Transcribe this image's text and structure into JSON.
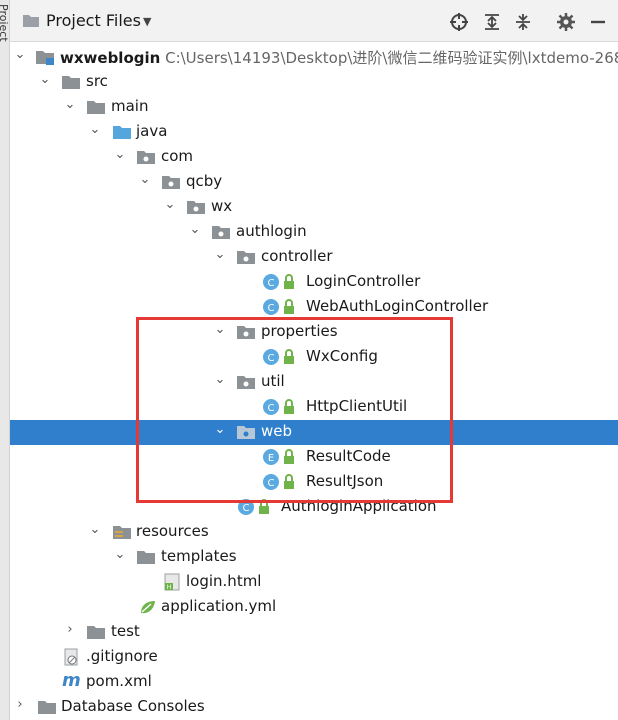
{
  "side_tab": "Project",
  "header": {
    "title": "Project Files"
  },
  "tree": {
    "root_name": "wxweblogin",
    "root_path": "C:\\Users\\14193\\Desktop\\进阶\\微信二维码验证实例\\lxtdemo-268",
    "src": "src",
    "main": "main",
    "java": "java",
    "com": "com",
    "qcby": "qcby",
    "wx": "wx",
    "authlogin": "authlogin",
    "controller": "controller",
    "login_controller": "LoginController",
    "web_auth_login_controller": "WebAuthLoginController",
    "properties": "properties",
    "wx_config": "WxConfig",
    "util": "util",
    "http_client_util": "HttpClientUtil",
    "web": "web",
    "result_code": "ResultCode",
    "result_json": "ResultJson",
    "authlogin_application": "AuthloginApplication",
    "resources": "resources",
    "templates": "templates",
    "login_html": "login.html",
    "application_yml": "application.yml",
    "test": "test",
    "gitignore": ".gitignore",
    "pom_xml": "pom.xml",
    "database_consoles": "Database Consoles"
  },
  "icons": {
    "header": [
      "folder-icon",
      "locate-icon",
      "expand-all-icon",
      "collapse-all-icon",
      "gear-icon",
      "hide-icon"
    ],
    "tree": [
      "folder-icon",
      "package-icon",
      "class-icon",
      "enum-icon",
      "lock-icon",
      "html-file-icon",
      "spring-icon",
      "gitignore-icon",
      "maven-icon"
    ]
  },
  "colors": {
    "selection": "#2f7fcc",
    "highlight_box": "#e53935",
    "class_icon": "#5aa9e0",
    "lock_icon": "#6fb34a"
  }
}
